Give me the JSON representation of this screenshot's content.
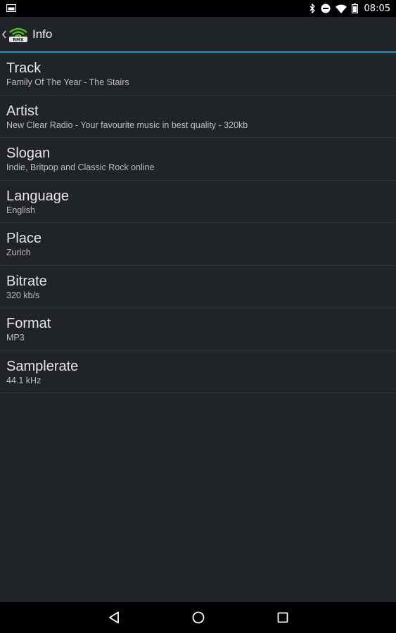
{
  "status_bar": {
    "time": "08:05",
    "icons": [
      "screenshot-icon",
      "bluetooth-icon",
      "do-not-disturb-icon",
      "wifi-icon",
      "battery-icon"
    ]
  },
  "action_bar": {
    "title": "Info",
    "logo_text": "RMX",
    "accent_color": "#2f8fc4"
  },
  "info": {
    "rows": [
      {
        "label": "Track",
        "value": "Family Of The Year - The Stairs"
      },
      {
        "label": "Artist",
        "value": "New Clear Radio - Your favourite music in best quality - 320kb"
      },
      {
        "label": "Slogan",
        "value": "Indie, Britpop and Classic Rock online"
      },
      {
        "label": "Language",
        "value": "English"
      },
      {
        "label": "Place",
        "value": "Zurich"
      },
      {
        "label": "Bitrate",
        "value": "320 kb/s"
      },
      {
        "label": "Format",
        "value": "MP3"
      },
      {
        "label": "Samplerate",
        "value": "44.1 kHz"
      }
    ]
  },
  "nav_bar": {
    "buttons": [
      "back-icon",
      "home-icon",
      "recents-icon"
    ]
  }
}
